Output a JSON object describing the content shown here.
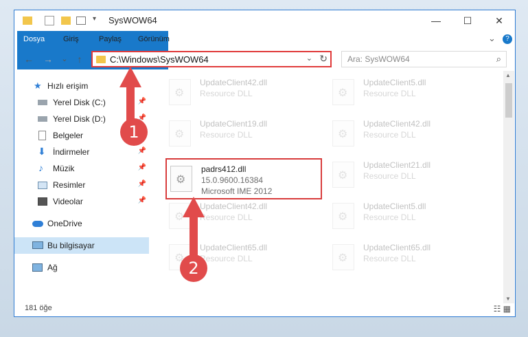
{
  "window": {
    "title": "SysWOW64",
    "min": "—",
    "max": "☐",
    "close": "✕"
  },
  "ribbon": {
    "tabs": [
      "Dosya",
      "Giriş",
      "Paylaş",
      "Görünüm"
    ],
    "expand": "⌄",
    "help": "?"
  },
  "nav": {
    "back": "←",
    "forward": "→",
    "recent": "⌄",
    "up": "↑",
    "address": "C:\\Windows\\SysWOW64",
    "address_dd": "⌄",
    "refresh": "↻",
    "search_placeholder": "Ara: SysWOW64",
    "search_icon": "⌕"
  },
  "sidebar": {
    "items": [
      {
        "label": "Hızlı erişim",
        "icon": "star-icon"
      },
      {
        "label": "Yerel Disk (C:)",
        "icon": "drive-icon",
        "pin": "📌"
      },
      {
        "label": "Yerel Disk (D:)",
        "icon": "drive-icon",
        "pin": "📌"
      },
      {
        "label": "Belgeler",
        "icon": "document-icon",
        "pin": "📌"
      },
      {
        "label": "İndirmeler",
        "icon": "download-icon",
        "pin": "📌"
      },
      {
        "label": "Müzik",
        "icon": "music-icon",
        "pin": "📌"
      },
      {
        "label": "Resimler",
        "icon": "pictures-icon",
        "pin": "📌"
      },
      {
        "label": "Videolar",
        "icon": "video-icon",
        "pin": "📌"
      },
      {
        "label": "OneDrive",
        "icon": "cloud-icon"
      },
      {
        "label": "Bu bilgisayar",
        "icon": "computer-icon"
      },
      {
        "label": "Ağ",
        "icon": "network-icon"
      }
    ]
  },
  "files": {
    "left": [
      {
        "name": "UpdateClient42.dll",
        "l1": "Resource DLL",
        "l2": ""
      },
      {
        "name": "UpdateClient19.dll",
        "l1": "Resource DLL",
        "l2": ""
      },
      {
        "name": "padrs412.dll",
        "l1": "15.0.9600.16384",
        "l2": "Microsoft IME 2012"
      },
      {
        "name": "UpdateClient42.dll",
        "l1": "Resource DLL",
        "l2": ""
      },
      {
        "name": "UpdateClient65.dll",
        "l1": "Resource DLL",
        "l2": ""
      }
    ],
    "right": [
      {
        "name": "UpdateClient5.dll",
        "l1": "Resource DLL",
        "l2": ""
      },
      {
        "name": "UpdateClient42.dll",
        "l1": "Resource DLL",
        "l2": ""
      },
      {
        "name": "UpdateClient21.dll",
        "l1": "Resource DLL",
        "l2": ""
      },
      {
        "name": "UpdateClient5.dll",
        "l1": "Resource DLL",
        "l2": ""
      },
      {
        "name": "UpdateClient65.dll",
        "l1": "Resource DLL",
        "l2": ""
      }
    ]
  },
  "status": {
    "count": "181 öğe",
    "views": "☷ ▦"
  },
  "annotations": {
    "badge1": "1",
    "badge2": "2",
    "color": "#e14b4b"
  }
}
